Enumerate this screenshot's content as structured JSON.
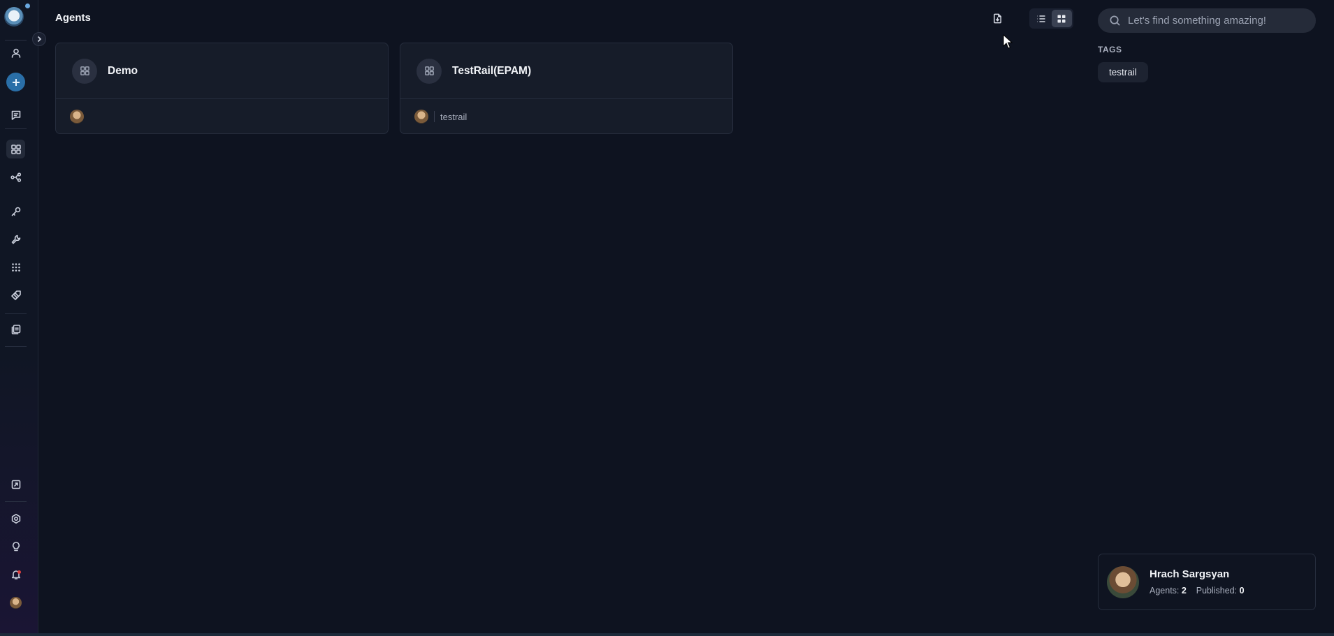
{
  "header": {
    "title": "Agents",
    "import_icon": "file-import-icon",
    "view_modes": [
      "list-view-icon",
      "grid-view-icon"
    ],
    "active_view": "grid"
  },
  "search": {
    "placeholder": "Let's find something amazing!",
    "icon": "search-icon"
  },
  "tags": {
    "title": "TAGS",
    "items": [
      "testrail"
    ]
  },
  "agents": [
    {
      "name": "Demo",
      "tag": ""
    },
    {
      "name": "TestRail(EPAM)",
      "tag": "testrail"
    }
  ],
  "profile": {
    "name": "Hrach Sargsyan",
    "agents_label": "Agents:",
    "agents_count": "2",
    "published_label": "Published:",
    "published_count": "0"
  },
  "sidebar": {
    "items": [
      "user-icon",
      "add-icon",
      "chat-icon",
      "agents-grid-icon",
      "pipelines-icon",
      "key-icon",
      "tools-icon",
      "apps-icon",
      "prompts-icon",
      "collections-icon",
      "releases-icon",
      "settings-icon",
      "ideas-icon",
      "notifications-icon",
      "avatar"
    ]
  },
  "colors": {
    "background": "#0e1320",
    "card": "#161c29",
    "accent": "#2a6fa8"
  }
}
